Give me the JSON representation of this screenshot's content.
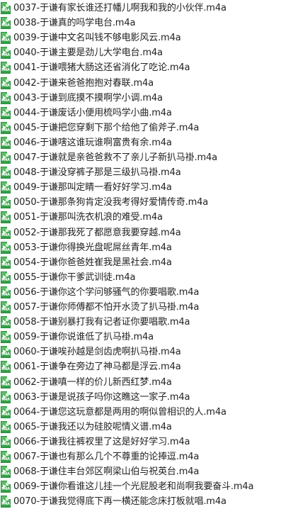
{
  "icon": {
    "name": "m4a-file-icon",
    "label": "M4A",
    "colors": {
      "body": "#2e9d42",
      "accent": "#62c26b",
      "fold": "#d7f0d8"
    }
  },
  "files": [
    {
      "name": "0037-于谦有家长谁还打幡儿啊我和我的小伙伴.m4a"
    },
    {
      "name": "0038-于谦真的吗学电台.m4a"
    },
    {
      "name": "0039-于谦中文名叫钱不够电影风云.m4a"
    },
    {
      "name": "0040-于谦主要是劲儿大学电台.m4a"
    },
    {
      "name": "0041-于谦喂猪大肠这还省消化了吃论.m4a"
    },
    {
      "name": "0042-于谦来爸爸抱抱对春联.m4a"
    },
    {
      "name": "0043-于谦到底摸不摸啊学小调.m4a"
    },
    {
      "name": "0044-于谦废话小便用梳吗学小曲.m4a"
    },
    {
      "name": "0045-于谦把您穿剩下那个给他了偷斧子.m4a"
    },
    {
      "name": "0046-于谦嗐这谁玩谁啊富贵有余.m4a"
    },
    {
      "name": "0047-于谦就是亲爸爸救不了亲儿子新扒马褂.m4a"
    },
    {
      "name": "0048-于谦没穿裤子那是三级扒马褂.m4a"
    },
    {
      "name": "0049-于谦那叫定睛一看好好学习.m4a"
    },
    {
      "name": "0050-于谦那条狗肯定没我考得好爱情传奇.m4a"
    },
    {
      "name": "0051-于谦那叫洗衣机浪的难受.m4a"
    },
    {
      "name": "0052-于谦那我死了都愿意我要穿越.m4a"
    },
    {
      "name": "0053-于谦你得换光盘呢屌丝青年.m4a"
    },
    {
      "name": "0054-于谦你爸爸姓崔我是黑社会.m4a"
    },
    {
      "name": "0055-于谦你干爹武训徒.m4a"
    },
    {
      "name": "0056-于谦你这个学问够骚气的你要唱歌.m4a"
    },
    {
      "name": "0057-于谦你师傅都不怕开水烫了扒马褂.m4a"
    },
    {
      "name": "0058-于谦别暴打我有记者证你要唱歌.m4a"
    },
    {
      "name": "0059-于谦你说谁低了扒马褂.m4a"
    },
    {
      "name": "0060-于谦唉孙越是剑齿虎啊扒马褂.m4a"
    },
    {
      "name": "0061-于谦争在旁边了神马都是浮云.m4a"
    },
    {
      "name": "0062-于谦嗔一样的价儿新西红梦.m4a"
    },
    {
      "name": "0063-于谦是说孩子吗你这瞧这一家子.m4a"
    },
    {
      "name": "0064-于谦您这玩意都是两用的啊似曾相识的人.m4a"
    },
    {
      "name": "0065-于谦我还以为硅胶呢情义谱.m4a"
    },
    {
      "name": "0066-于谦我往裤衩里了这是好好学习.m4a"
    },
    {
      "name": "0067-于谦也有那么几个不尊重的论捧逗.m4a"
    },
    {
      "name": "0068-于谦住丰台郊区啊梁山伯与祝英台.m4a"
    },
    {
      "name": "0069-于谦你看谁这儿挂一个光屁股老和尚啊我要奋斗.m4a"
    },
    {
      "name": "0070-于谦我觉得底下再一横还能念床打板就唱.m4a"
    }
  ]
}
